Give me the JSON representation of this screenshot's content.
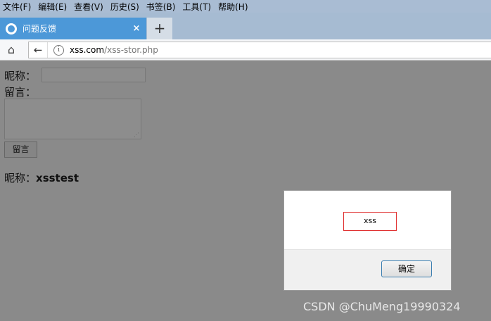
{
  "menu": [
    "文件(F)",
    "编辑(E)",
    "查看(V)",
    "历史(S)",
    "书签(B)",
    "工具(T)",
    "帮助(H)"
  ],
  "tab": {
    "title": "问题反馈",
    "close": "×",
    "new_tab": "+"
  },
  "nav": {
    "home": "⌂",
    "back": "←",
    "info": "i",
    "url_domain": "xss.com",
    "url_path": "/xss-stor.php"
  },
  "form": {
    "nickname_label": "昵称：",
    "message_label": "留言：",
    "submit_label": "留言",
    "nickname_value": ""
  },
  "result": {
    "label": "昵称：",
    "value": "xsstest"
  },
  "dialog": {
    "message": "xss",
    "ok_label": "确定"
  },
  "watermark": "CSDN @ChuMeng19990324"
}
